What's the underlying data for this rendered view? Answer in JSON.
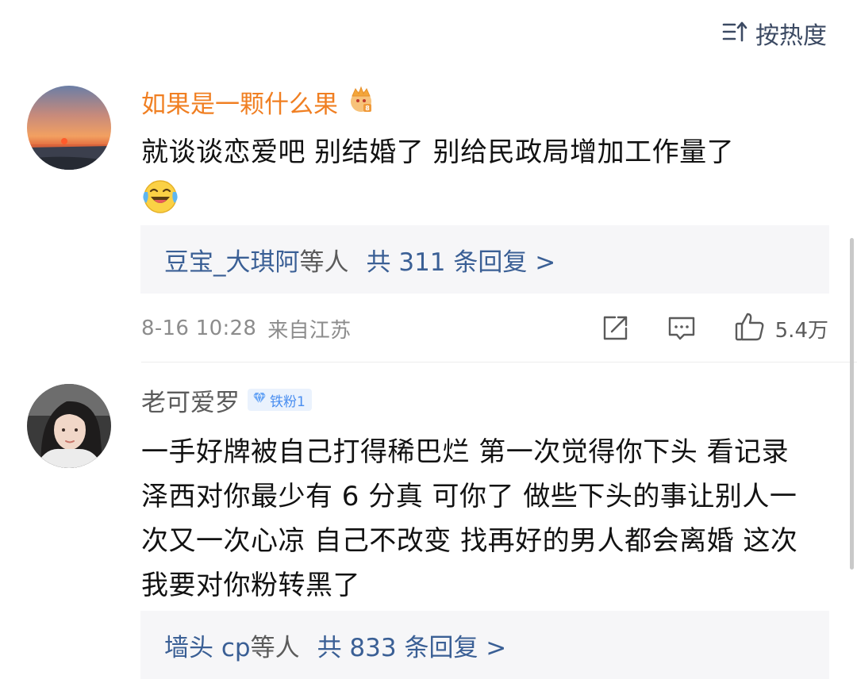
{
  "sort": {
    "label": "按热度",
    "icon": "sort-icon"
  },
  "comments": [
    {
      "username": "如果是一颗什么果",
      "username_color": "#f07f22",
      "badge_icon": "vip-crown-icon",
      "text": "就谈谈恋爱吧 别结婚了 别给民政局增加工作量了",
      "emoji": "laughing-crying-emoji",
      "replies": {
        "who": "豆宝_大琪阿",
        "tail": "等人",
        "count": "共 311 条回复 >"
      },
      "time": "8-16 10:28",
      "source": "来自江苏",
      "likes": "5.4万"
    },
    {
      "username": "老可爱罗",
      "username_color": "#5b5b5b",
      "badge": "铁粉1",
      "badge_color": "#4a8ef0",
      "text": "一手好牌被自己打得稀巴烂 第一次觉得你下头 看记录泽西对你最少有 6 分真 可你了 做些下头的事让别人一次又一次心凉 自己不改变 找再好的男人都会离婚 这次我要对你粉转黑了",
      "replies": {
        "who": "墙头 cp",
        "tail": "等人",
        "count": "共 833 条回复 >"
      }
    }
  ],
  "colors": {
    "link_blue": "#3a5f95",
    "meta_gray": "#8c8c8c",
    "reply_bg": "#f6f6f8"
  }
}
